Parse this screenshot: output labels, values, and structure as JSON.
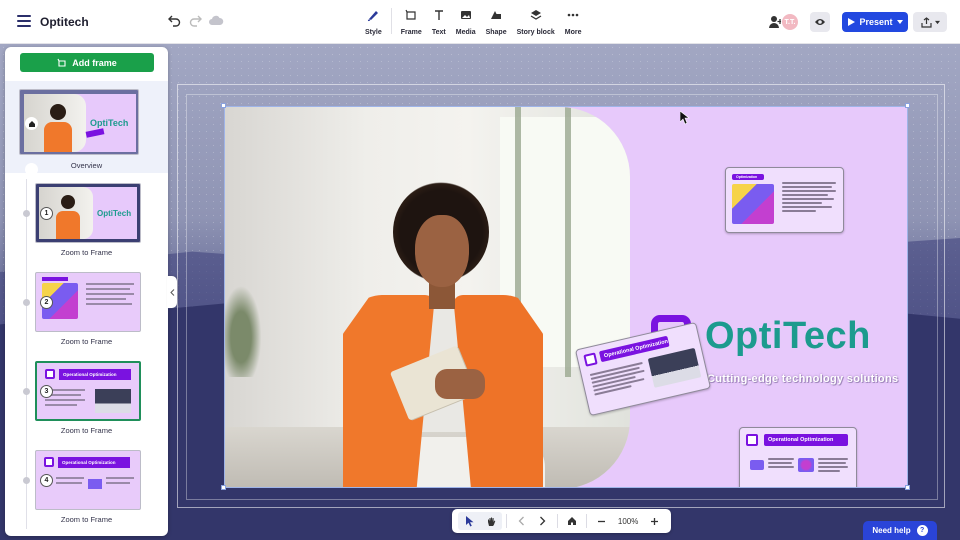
{
  "app": {
    "title": "Optitech"
  },
  "toolbar": {
    "tools": [
      {
        "label": "Style",
        "icon": "pen-icon"
      },
      {
        "label": "Frame",
        "icon": "frame-icon"
      },
      {
        "label": "Text",
        "icon": "text-icon"
      },
      {
        "label": "Media",
        "icon": "image-icon"
      },
      {
        "label": "Shape",
        "icon": "shape-icon"
      },
      {
        "label": "Story block",
        "icon": "layers-icon"
      },
      {
        "label": "More",
        "icon": "more-icon"
      }
    ],
    "avatar_initials": "T.T.",
    "present_label": "Present"
  },
  "panel": {
    "add_frame_label": "Add frame",
    "overview_label": "Overview",
    "frames": [
      {
        "number": "1",
        "label": "Zoom to Frame"
      },
      {
        "number": "2",
        "label": "Zoom to Frame"
      },
      {
        "number": "3",
        "label": "Zoom to Frame"
      },
      {
        "number": "4",
        "label": "Zoom to Frame"
      }
    ]
  },
  "slide": {
    "logo_text": "OptiTech",
    "tagline": "Cutting-edge technology solutions",
    "card_title": "Operational Optimization",
    "card_small_title": "Optimization",
    "thumb_logo": "OptiTech"
  },
  "bottombar": {
    "zoom": "100%"
  },
  "help": {
    "label": "Need help",
    "q": "?"
  },
  "colors": {
    "brand_purple": "#7a12e0",
    "brand_teal": "#1c9b8e",
    "present_blue": "#2248e0",
    "add_green": "#1aa04a"
  }
}
